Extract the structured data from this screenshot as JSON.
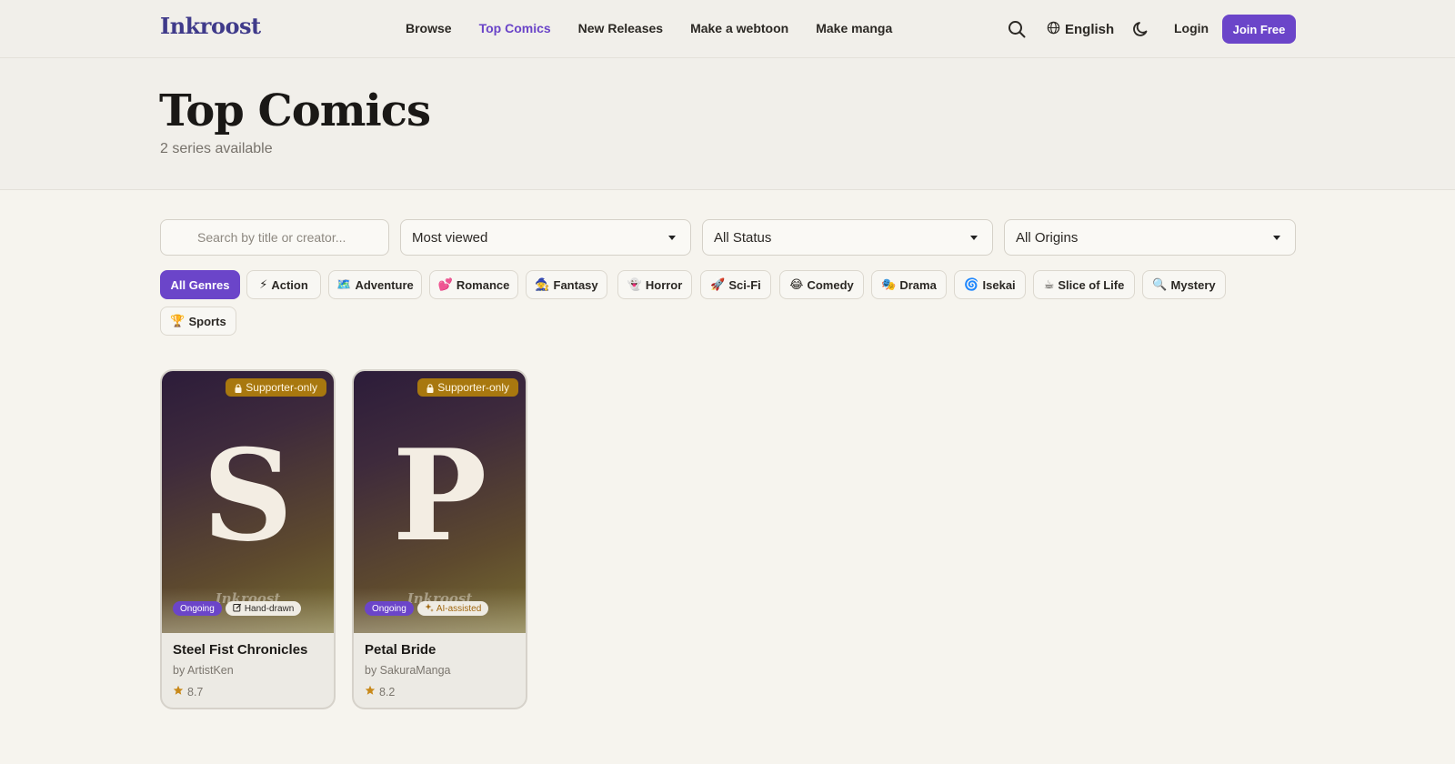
{
  "header": {
    "logo_main": "Inkroost",
    "nav": [
      {
        "label": "Browse",
        "active": false
      },
      {
        "label": "Top Comics",
        "active": true
      },
      {
        "label": "New Releases",
        "active": false
      },
      {
        "label": "Make a webtoon",
        "active": false
      },
      {
        "label": "Make manga",
        "active": false
      }
    ],
    "language": "English",
    "login_label": "Login",
    "join_label": "Join Free",
    "icons": [
      "search-icon",
      "globe-icon",
      "moon-icon"
    ]
  },
  "hero": {
    "title": "Top Comics",
    "subtitle": "2 series available"
  },
  "filters": {
    "search_placeholder": "Search by title or creator...",
    "sort_value": "Most viewed",
    "status_value": "All Status",
    "origin_value": "All Origins"
  },
  "genres": [
    {
      "label": "All Genres",
      "emoji": "",
      "active": true
    },
    {
      "label": "Action",
      "emoji": "⚡",
      "active": false
    },
    {
      "label": "Adventure",
      "emoji": "🗺️",
      "active": false
    },
    {
      "label": "Romance",
      "emoji": "💕",
      "active": false
    },
    {
      "label": "Fantasy",
      "emoji": "🧙",
      "active": false
    },
    {
      "label": "Horror",
      "emoji": "👻",
      "active": false
    },
    {
      "label": "Sci-Fi",
      "emoji": "🚀",
      "active": false
    },
    {
      "label": "Comedy",
      "emoji": "😂",
      "active": false
    },
    {
      "label": "Drama",
      "emoji": "🎭",
      "active": false
    },
    {
      "label": "Isekai",
      "emoji": "🌀",
      "active": false
    },
    {
      "label": "Slice of Life",
      "emoji": "☕",
      "active": false
    },
    {
      "label": "Mystery",
      "emoji": "🔍",
      "active": false
    },
    {
      "label": "Sports",
      "emoji": "🏆",
      "active": false
    }
  ],
  "cards": [
    {
      "letter": "S",
      "watermark": "Inkroost",
      "badge": "Supporter-only",
      "status": "Ongoing",
      "method": "Hand-drawn",
      "method_icon": "pencil-icon",
      "title": "Steel Fist Chronicles",
      "creator": "by ArtistKen",
      "rating": "8.7"
    },
    {
      "letter": "P",
      "watermark": "Inkroost",
      "badge": "Supporter-only",
      "status": "Ongoing",
      "method": "AI-assisted",
      "method_icon": "sparkle-icon",
      "title": "Petal Bride",
      "creator": "by SakuraManga",
      "rating": "8.2"
    }
  ],
  "colors": {
    "accent": "#6b45c9",
    "supporter_badge": "#a8780f",
    "star": "#c8891a",
    "background": "#f6f4ee"
  }
}
